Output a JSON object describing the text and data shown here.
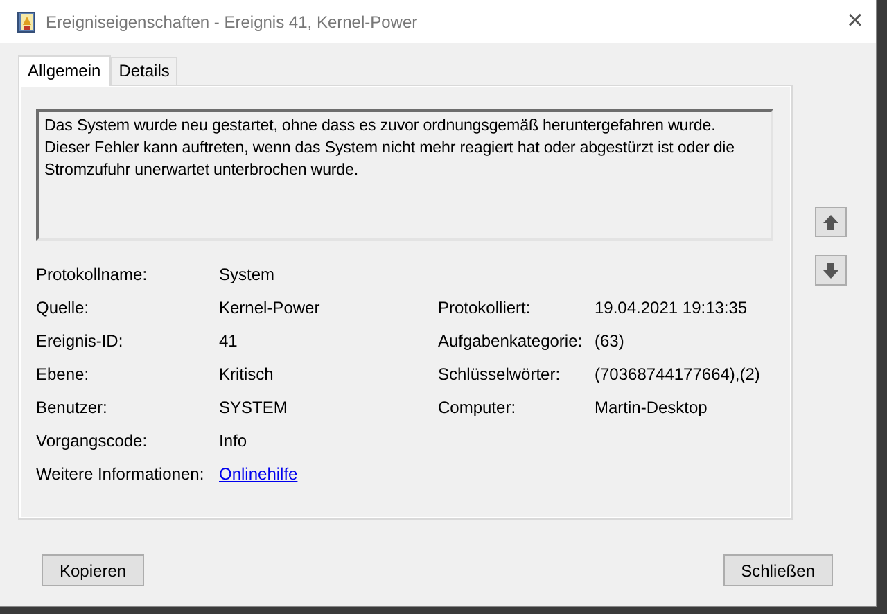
{
  "window": {
    "title": "Ereigniseigenschaften - Ereignis 41, Kernel-Power",
    "close": "×"
  },
  "tabs": [
    {
      "label": "Allgemein",
      "selected": true
    },
    {
      "label": "Details",
      "selected": false
    }
  ],
  "description": "Das System wurde neu gestartet, ohne dass es zuvor ordnungsgemäß heruntergefahren wurde. Dieser Fehler kann auftreten, wenn das System nicht mehr reagiert hat oder abgestürzt ist oder die Stromzufuhr unerwartet unterbrochen wurde.",
  "fields": [
    {
      "label": "Protokollname:",
      "value": "System",
      "kind": "text"
    },
    {
      "label": "Quelle:",
      "value": "Kernel-Power",
      "kind": "text",
      "right": {
        "label": "Protokolliert:",
        "value": "19.04.2021 19:13:35"
      }
    },
    {
      "label": "Ereignis-ID:",
      "value": "41",
      "kind": "text",
      "right": {
        "label": "Aufgabenkategorie:",
        "value": "(63)"
      }
    },
    {
      "label": "Ebene:",
      "value": "Kritisch",
      "kind": "text",
      "right": {
        "label": "Schlüsselwörter:",
        "value": "(70368744177664),(2)"
      }
    },
    {
      "label": "Benutzer:",
      "value": "SYSTEM",
      "kind": "text",
      "right": {
        "label": "Computer:",
        "value": "Martin-Desktop"
      }
    },
    {
      "label": "Vorgangscode:",
      "value": "Info",
      "kind": "text"
    },
    {
      "label": "Weitere Informationen:",
      "value": "Onlinehilfe",
      "kind": "link"
    }
  ],
  "buttons": [
    {
      "label": "Kopieren"
    },
    {
      "label": "Schließen"
    }
  ]
}
